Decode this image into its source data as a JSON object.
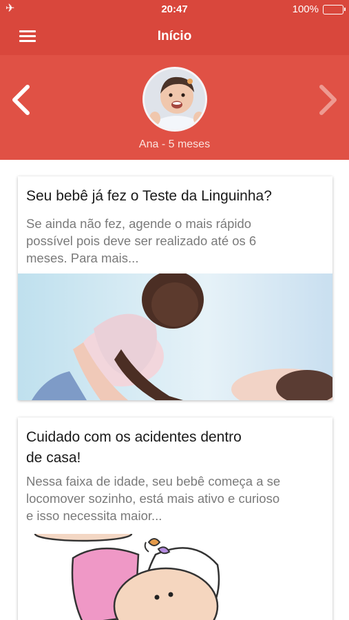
{
  "status_bar": {
    "time": "20:47",
    "battery": "100%",
    "airplane_glyph": "✈"
  },
  "header": {
    "title": "Início"
  },
  "profile": {
    "child_name": "Ana",
    "separator": "-",
    "age": "5 meses"
  },
  "articles": [
    {
      "title": "Seu bebê já fez o Teste da Linguinha?",
      "excerpt_lines": [
        "Se ainda não fez, agende o mais rápido",
        "possível pois deve ser realizado até os 6",
        "meses.  Para mais..."
      ]
    },
    {
      "title_lines": [
        "Cuidado com os acidentes dentro",
        "de casa!"
      ],
      "excerpt_lines": [
        "Nessa faixa de idade, seu bebê começa a se",
        "locomover sozinho, está mais ativo e curioso",
        "e isso necessita maior..."
      ]
    }
  ],
  "colors": {
    "header_red": "#d9473c",
    "profile_red": "#e05145"
  },
  "icons": [
    "airplane-icon",
    "battery-icon",
    "menu-icon",
    "chevron-left-icon",
    "chevron-right-icon"
  ]
}
